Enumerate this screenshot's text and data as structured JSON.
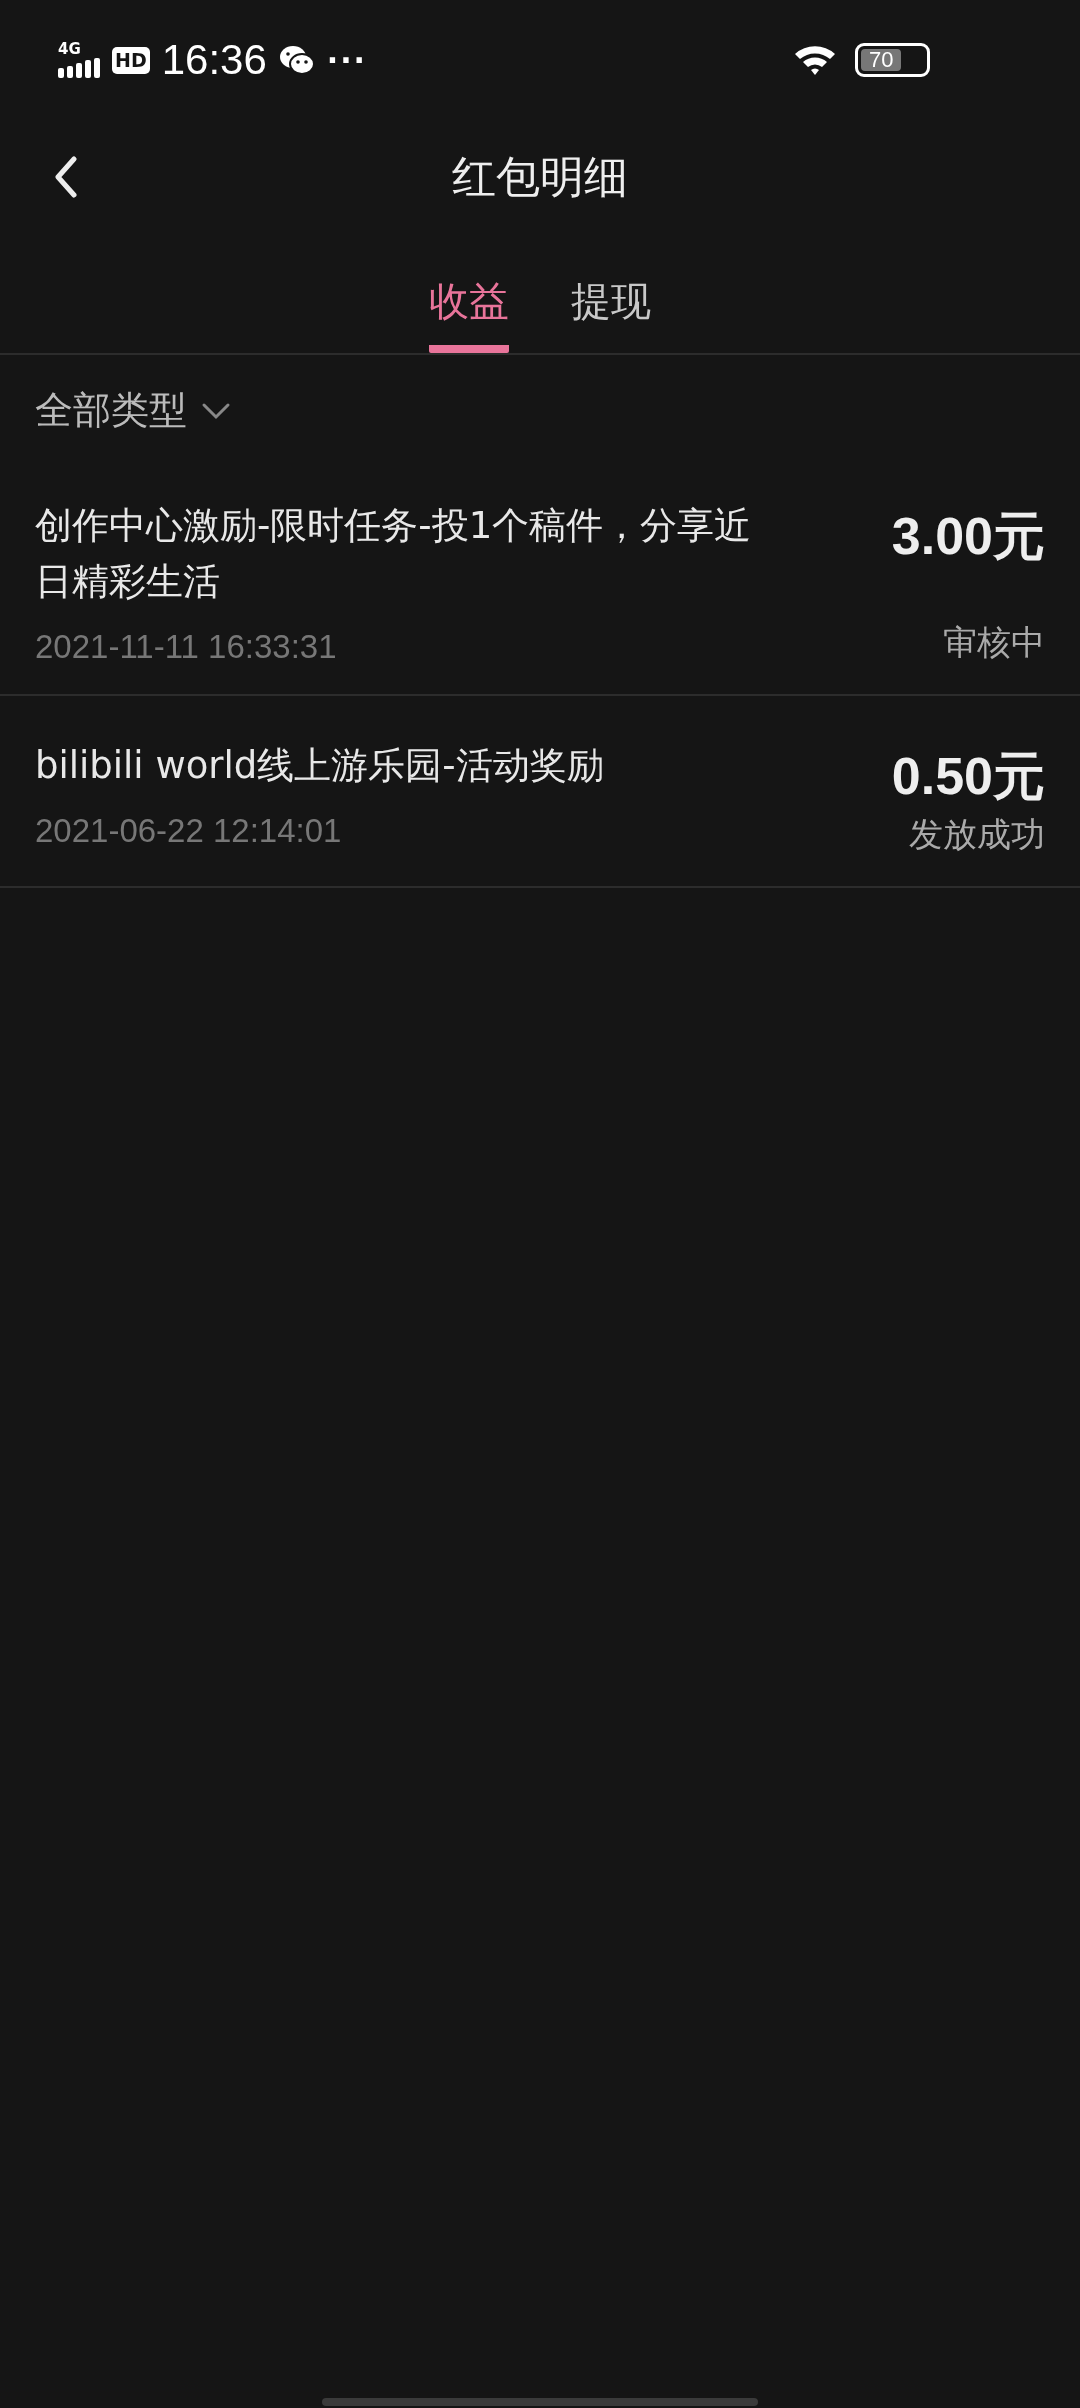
{
  "status_bar": {
    "network": "4G",
    "hd": "HD",
    "time": "16:36",
    "more": "···",
    "battery": "70"
  },
  "header": {
    "title": "红包明细"
  },
  "tabs": [
    {
      "label": "收益",
      "selected": true
    },
    {
      "label": "提现",
      "selected": false
    }
  ],
  "filter": {
    "label": "全部类型"
  },
  "records": [
    {
      "title": "创作中心激励-限时任务-投1个稿件，分享近日精彩生活",
      "time": "2021-11-11 16:33:31",
      "amount": "3.00元",
      "status": "审核中"
    },
    {
      "title": "bilibili world线上游乐园-活动奖励",
      "time": "2021-06-22 12:14:01",
      "amount": "0.50元",
      "status": "发放成功"
    }
  ]
}
